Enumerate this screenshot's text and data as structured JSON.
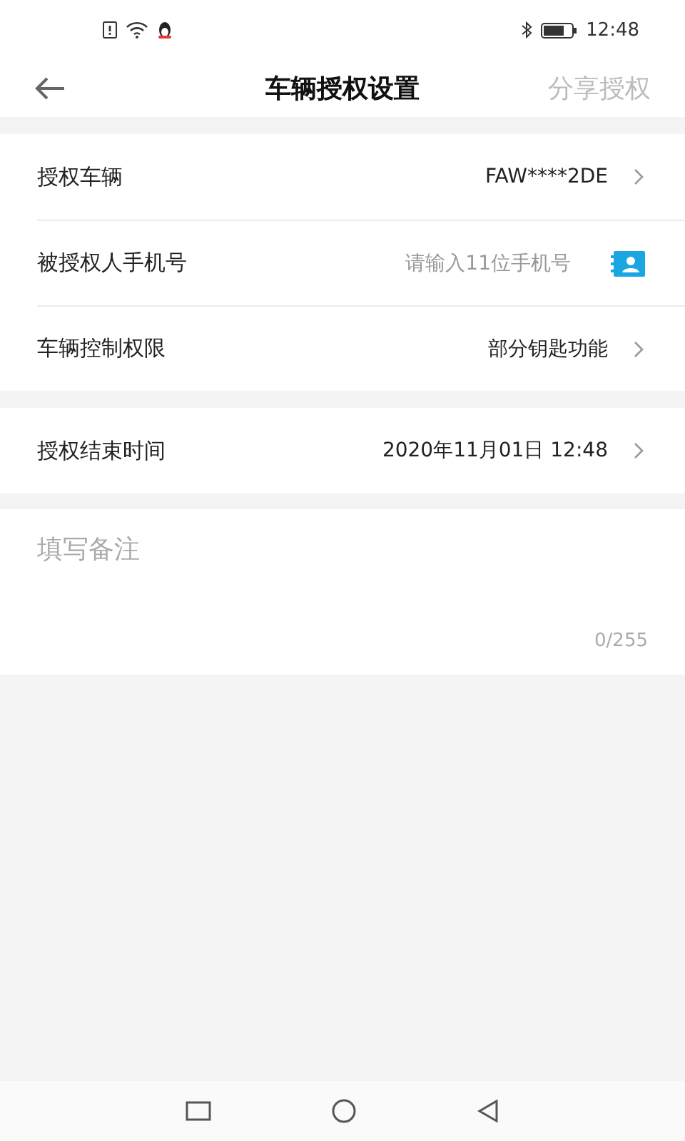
{
  "status_bar": {
    "time": "12:48"
  },
  "header": {
    "title": "车辆授权设置",
    "action": "分享授权"
  },
  "groups": [
    {
      "rows": [
        {
          "kind": "select",
          "label": "授权车辆",
          "value": "FAW****2DE"
        },
        {
          "kind": "input",
          "label": "被授权人手机号",
          "placeholder": "请输入11位手机号"
        },
        {
          "kind": "select",
          "label": "车辆控制权限",
          "value": "部分钥匙功能"
        }
      ]
    },
    {
      "rows": [
        {
          "kind": "select",
          "label": "授权结束时间",
          "value": "2020年11月01日 12:48"
        }
      ]
    }
  ],
  "notes": {
    "placeholder": "填写备注",
    "counter": "0/255"
  }
}
